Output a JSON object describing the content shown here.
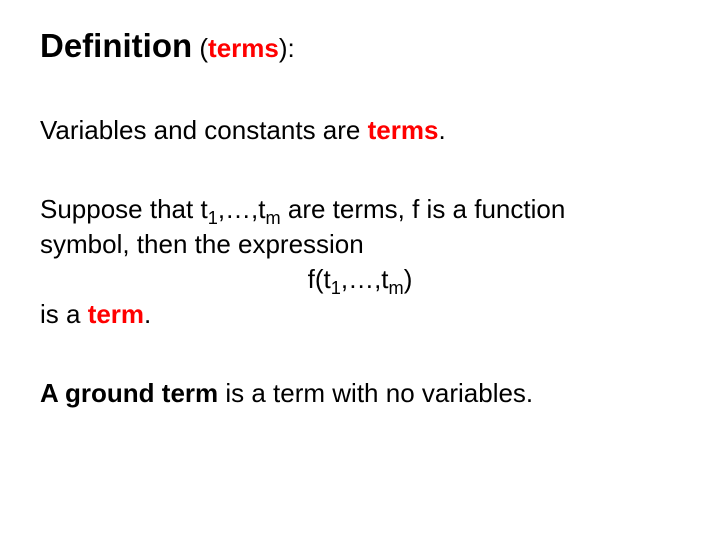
{
  "heading": {
    "label": "Definition",
    "paren_open": " (",
    "terms_word": "terms",
    "paren_close": ")",
    "colon": ":"
  },
  "p1": {
    "a": "Variables and constants are ",
    "b": "terms",
    "c": "."
  },
  "p2": {
    "l1a": "Suppose that t",
    "l1_sub1": "1",
    "l1b": ",…,t",
    "l1_subm": "m",
    "l1c": " are terms, f is a function",
    "l2": "symbol, then the  expression",
    "l3a": "f(t",
    "l3_sub1": "1",
    "l3b": ",…,t",
    "l3_subm": "m",
    "l3c": ")",
    "l4a": "is a ",
    "l4b": "term",
    "l4c": "."
  },
  "p3": {
    "a": "A ground term",
    "b": " is a term with no variables."
  }
}
